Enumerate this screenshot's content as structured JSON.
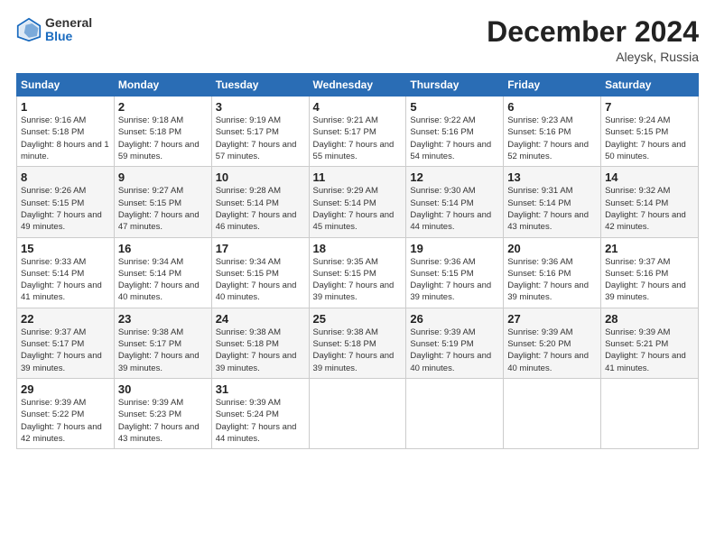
{
  "header": {
    "logo_general": "General",
    "logo_blue": "Blue",
    "month_title": "December 2024",
    "location": "Aleysk, Russia"
  },
  "days_of_week": [
    "Sunday",
    "Monday",
    "Tuesday",
    "Wednesday",
    "Thursday",
    "Friday",
    "Saturday"
  ],
  "weeks": [
    [
      {
        "day": "1",
        "sunrise": "Sunrise: 9:16 AM",
        "sunset": "Sunset: 5:18 PM",
        "daylight": "Daylight: 8 hours and 1 minute."
      },
      {
        "day": "2",
        "sunrise": "Sunrise: 9:18 AM",
        "sunset": "Sunset: 5:18 PM",
        "daylight": "Daylight: 7 hours and 59 minutes."
      },
      {
        "day": "3",
        "sunrise": "Sunrise: 9:19 AM",
        "sunset": "Sunset: 5:17 PM",
        "daylight": "Daylight: 7 hours and 57 minutes."
      },
      {
        "day": "4",
        "sunrise": "Sunrise: 9:21 AM",
        "sunset": "Sunset: 5:17 PM",
        "daylight": "Daylight: 7 hours and 55 minutes."
      },
      {
        "day": "5",
        "sunrise": "Sunrise: 9:22 AM",
        "sunset": "Sunset: 5:16 PM",
        "daylight": "Daylight: 7 hours and 54 minutes."
      },
      {
        "day": "6",
        "sunrise": "Sunrise: 9:23 AM",
        "sunset": "Sunset: 5:16 PM",
        "daylight": "Daylight: 7 hours and 52 minutes."
      },
      {
        "day": "7",
        "sunrise": "Sunrise: 9:24 AM",
        "sunset": "Sunset: 5:15 PM",
        "daylight": "Daylight: 7 hours and 50 minutes."
      }
    ],
    [
      {
        "day": "8",
        "sunrise": "Sunrise: 9:26 AM",
        "sunset": "Sunset: 5:15 PM",
        "daylight": "Daylight: 7 hours and 49 minutes."
      },
      {
        "day": "9",
        "sunrise": "Sunrise: 9:27 AM",
        "sunset": "Sunset: 5:15 PM",
        "daylight": "Daylight: 7 hours and 47 minutes."
      },
      {
        "day": "10",
        "sunrise": "Sunrise: 9:28 AM",
        "sunset": "Sunset: 5:14 PM",
        "daylight": "Daylight: 7 hours and 46 minutes."
      },
      {
        "day": "11",
        "sunrise": "Sunrise: 9:29 AM",
        "sunset": "Sunset: 5:14 PM",
        "daylight": "Daylight: 7 hours and 45 minutes."
      },
      {
        "day": "12",
        "sunrise": "Sunrise: 9:30 AM",
        "sunset": "Sunset: 5:14 PM",
        "daylight": "Daylight: 7 hours and 44 minutes."
      },
      {
        "day": "13",
        "sunrise": "Sunrise: 9:31 AM",
        "sunset": "Sunset: 5:14 PM",
        "daylight": "Daylight: 7 hours and 43 minutes."
      },
      {
        "day": "14",
        "sunrise": "Sunrise: 9:32 AM",
        "sunset": "Sunset: 5:14 PM",
        "daylight": "Daylight: 7 hours and 42 minutes."
      }
    ],
    [
      {
        "day": "15",
        "sunrise": "Sunrise: 9:33 AM",
        "sunset": "Sunset: 5:14 PM",
        "daylight": "Daylight: 7 hours and 41 minutes."
      },
      {
        "day": "16",
        "sunrise": "Sunrise: 9:34 AM",
        "sunset": "Sunset: 5:14 PM",
        "daylight": "Daylight: 7 hours and 40 minutes."
      },
      {
        "day": "17",
        "sunrise": "Sunrise: 9:34 AM",
        "sunset": "Sunset: 5:15 PM",
        "daylight": "Daylight: 7 hours and 40 minutes."
      },
      {
        "day": "18",
        "sunrise": "Sunrise: 9:35 AM",
        "sunset": "Sunset: 5:15 PM",
        "daylight": "Daylight: 7 hours and 39 minutes."
      },
      {
        "day": "19",
        "sunrise": "Sunrise: 9:36 AM",
        "sunset": "Sunset: 5:15 PM",
        "daylight": "Daylight: 7 hours and 39 minutes."
      },
      {
        "day": "20",
        "sunrise": "Sunrise: 9:36 AM",
        "sunset": "Sunset: 5:16 PM",
        "daylight": "Daylight: 7 hours and 39 minutes."
      },
      {
        "day": "21",
        "sunrise": "Sunrise: 9:37 AM",
        "sunset": "Sunset: 5:16 PM",
        "daylight": "Daylight: 7 hours and 39 minutes."
      }
    ],
    [
      {
        "day": "22",
        "sunrise": "Sunrise: 9:37 AM",
        "sunset": "Sunset: 5:17 PM",
        "daylight": "Daylight: 7 hours and 39 minutes."
      },
      {
        "day": "23",
        "sunrise": "Sunrise: 9:38 AM",
        "sunset": "Sunset: 5:17 PM",
        "daylight": "Daylight: 7 hours and 39 minutes."
      },
      {
        "day": "24",
        "sunrise": "Sunrise: 9:38 AM",
        "sunset": "Sunset: 5:18 PM",
        "daylight": "Daylight: 7 hours and 39 minutes."
      },
      {
        "day": "25",
        "sunrise": "Sunrise: 9:38 AM",
        "sunset": "Sunset: 5:18 PM",
        "daylight": "Daylight: 7 hours and 39 minutes."
      },
      {
        "day": "26",
        "sunrise": "Sunrise: 9:39 AM",
        "sunset": "Sunset: 5:19 PM",
        "daylight": "Daylight: 7 hours and 40 minutes."
      },
      {
        "day": "27",
        "sunrise": "Sunrise: 9:39 AM",
        "sunset": "Sunset: 5:20 PM",
        "daylight": "Daylight: 7 hours and 40 minutes."
      },
      {
        "day": "28",
        "sunrise": "Sunrise: 9:39 AM",
        "sunset": "Sunset: 5:21 PM",
        "daylight": "Daylight: 7 hours and 41 minutes."
      }
    ],
    [
      {
        "day": "29",
        "sunrise": "Sunrise: 9:39 AM",
        "sunset": "Sunset: 5:22 PM",
        "daylight": "Daylight: 7 hours and 42 minutes."
      },
      {
        "day": "30",
        "sunrise": "Sunrise: 9:39 AM",
        "sunset": "Sunset: 5:23 PM",
        "daylight": "Daylight: 7 hours and 43 minutes."
      },
      {
        "day": "31",
        "sunrise": "Sunrise: 9:39 AM",
        "sunset": "Sunset: 5:24 PM",
        "daylight": "Daylight: 7 hours and 44 minutes."
      },
      {
        "day": "",
        "sunrise": "",
        "sunset": "",
        "daylight": ""
      },
      {
        "day": "",
        "sunrise": "",
        "sunset": "",
        "daylight": ""
      },
      {
        "day": "",
        "sunrise": "",
        "sunset": "",
        "daylight": ""
      },
      {
        "day": "",
        "sunrise": "",
        "sunset": "",
        "daylight": ""
      }
    ]
  ]
}
